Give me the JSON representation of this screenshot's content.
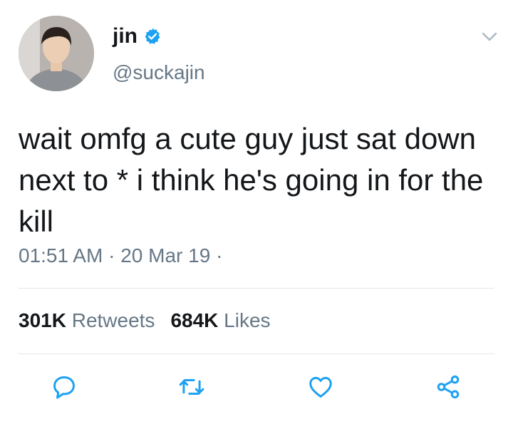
{
  "author": {
    "display_name": "jin",
    "handle": "@suckajin",
    "verified": true,
    "verified_color": "#1da1f2"
  },
  "tweet": {
    "text": "wait omfg a cute guy just sat down next to * i think he's going in for the kill",
    "time": "01:51 AM",
    "date": "20 Mar 19"
  },
  "stats": {
    "retweets_count": "301K",
    "retweets_label": "Retweets",
    "likes_count": "684K",
    "likes_label": "Likes"
  },
  "icons": {
    "reply": "reply-icon",
    "retweet": "retweet-icon",
    "like": "heart-icon",
    "share": "share-icon",
    "menu": "chevron-down-icon"
  },
  "colors": {
    "text": "#14171a",
    "secondary": "#657786",
    "divider": "#e1e8ed",
    "icon": "#1da1f2"
  }
}
